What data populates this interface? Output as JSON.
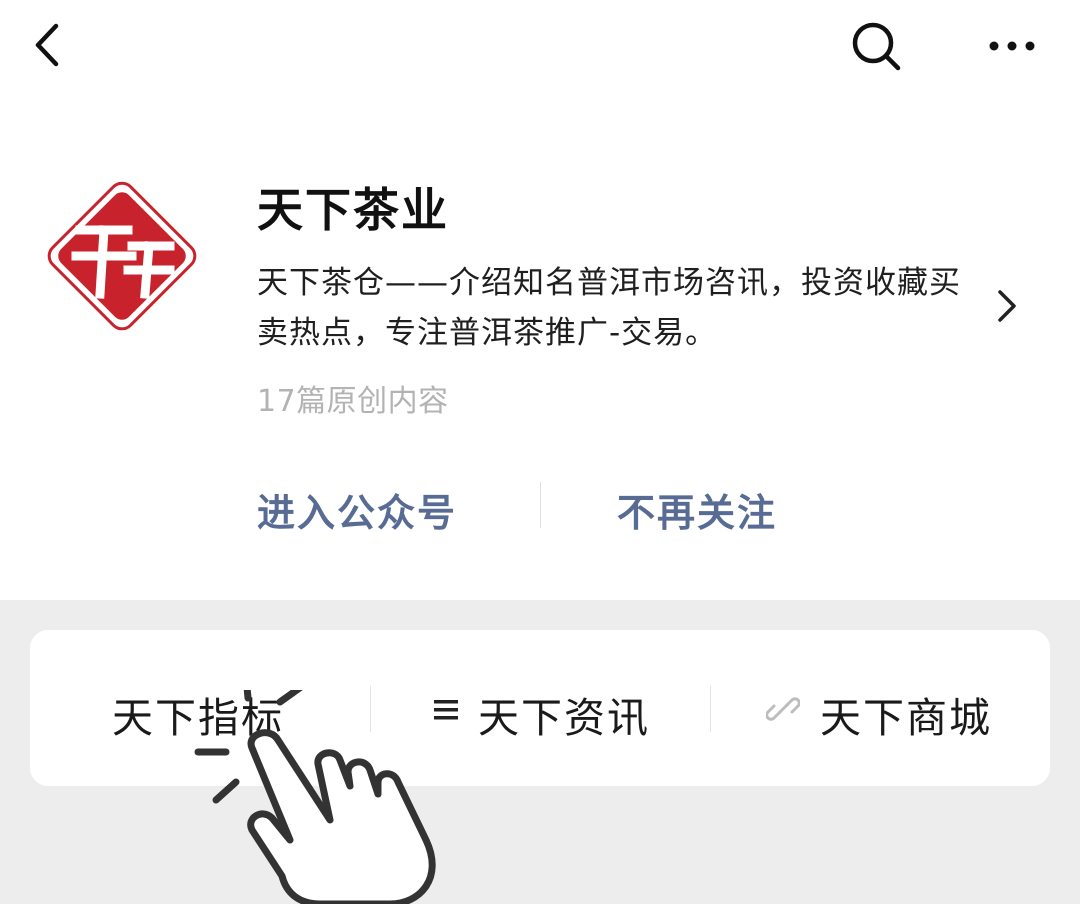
{
  "header": {
    "back_icon": "chevron-left-icon",
    "search_icon": "search-icon",
    "more_icon": "more-dots-icon"
  },
  "account": {
    "name": "天下茶业",
    "description": "天下茶仓——介绍知名普洱市场咨讯，投资收藏买卖热点，专注普洱茶推广-交易。",
    "original_count": "17篇原创内容",
    "logo_icon": "tianxia-diamond-logo",
    "arrow_icon": "chevron-right-icon"
  },
  "actions": {
    "enter": "进入公众号",
    "unfollow": "不再关注"
  },
  "menu": [
    {
      "label": "天下指标",
      "icon": ""
    },
    {
      "label": "天下资讯",
      "icon": "list-icon"
    },
    {
      "label": "天下商城",
      "icon": "link-icon"
    }
  ],
  "overlay": {
    "pointer_icon": "tap-hand-icon"
  },
  "colors": {
    "link_blue": "#576b95",
    "logo_red": "#c8232c",
    "background_gray": "#ededed"
  }
}
